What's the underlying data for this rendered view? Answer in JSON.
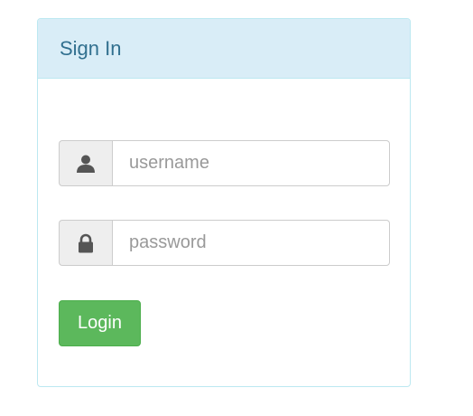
{
  "panel": {
    "title": "Sign In"
  },
  "form": {
    "username": {
      "icon": "user-icon",
      "value": "",
      "placeholder": "username"
    },
    "password": {
      "icon": "lock-icon",
      "value": "",
      "placeholder": "password"
    },
    "login_label": "Login"
  },
  "colors": {
    "heading_bg": "#d9edf7",
    "heading_text": "#31708f",
    "panel_border": "#bce8f1",
    "addon_bg": "#eeeeee",
    "button_bg": "#5cb85c",
    "icon_color": "#555555"
  }
}
